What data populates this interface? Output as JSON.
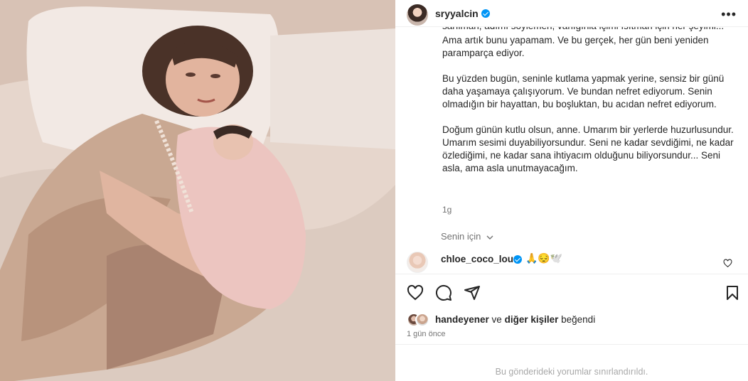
{
  "post": {
    "username": "sryyalcin",
    "more_icon": "more-horizontal-icon",
    "caption": {
      "cut_line": "sarılman, adımı söylemen, varlığınla içimi ısıtman için her şeyimi...",
      "p1": "Ama artık bunu yapamam. Ve bu gerçek, her gün beni yeniden paramparça ediyor.",
      "p2": "Bu yüzden bugün, seninle kutlama yapmak yerine, sensiz bir günü daha yaşamaya çalışıyorum. Ve bundan nefret ediyorum. Senin olmadığın bir hayattan, bu boşluktan, bu acıdan nefret ediyorum.",
      "p3": "Doğum günün kutlu olsun, anne. Umarım bir yerlerde huzurlusundur. Umarım sesimi duyabiliyorsundur. Seni ne kadar sevdiğimi, ne kadar özlediğimi, ne kadar sana ihtiyacım olduğunu biliyorsundur... Seni asla, ama asla unutmayacağım."
    },
    "caption_time": "1g",
    "for_you": "Senin için",
    "comment": {
      "username": "chloe_coco_lou",
      "emojis": "🙏😔🕊️"
    },
    "likes": {
      "user": "handeyener",
      "and": "ve",
      "others": "diğer kişiler",
      "liked": "beğendi"
    },
    "date": "1 gün önce",
    "comments_restricted": "Bu gönderideki yorumlar sınırlandırıldı."
  },
  "colors": {
    "verified": "#0095f6",
    "muted_text": "#737373",
    "border": "#efefef"
  }
}
